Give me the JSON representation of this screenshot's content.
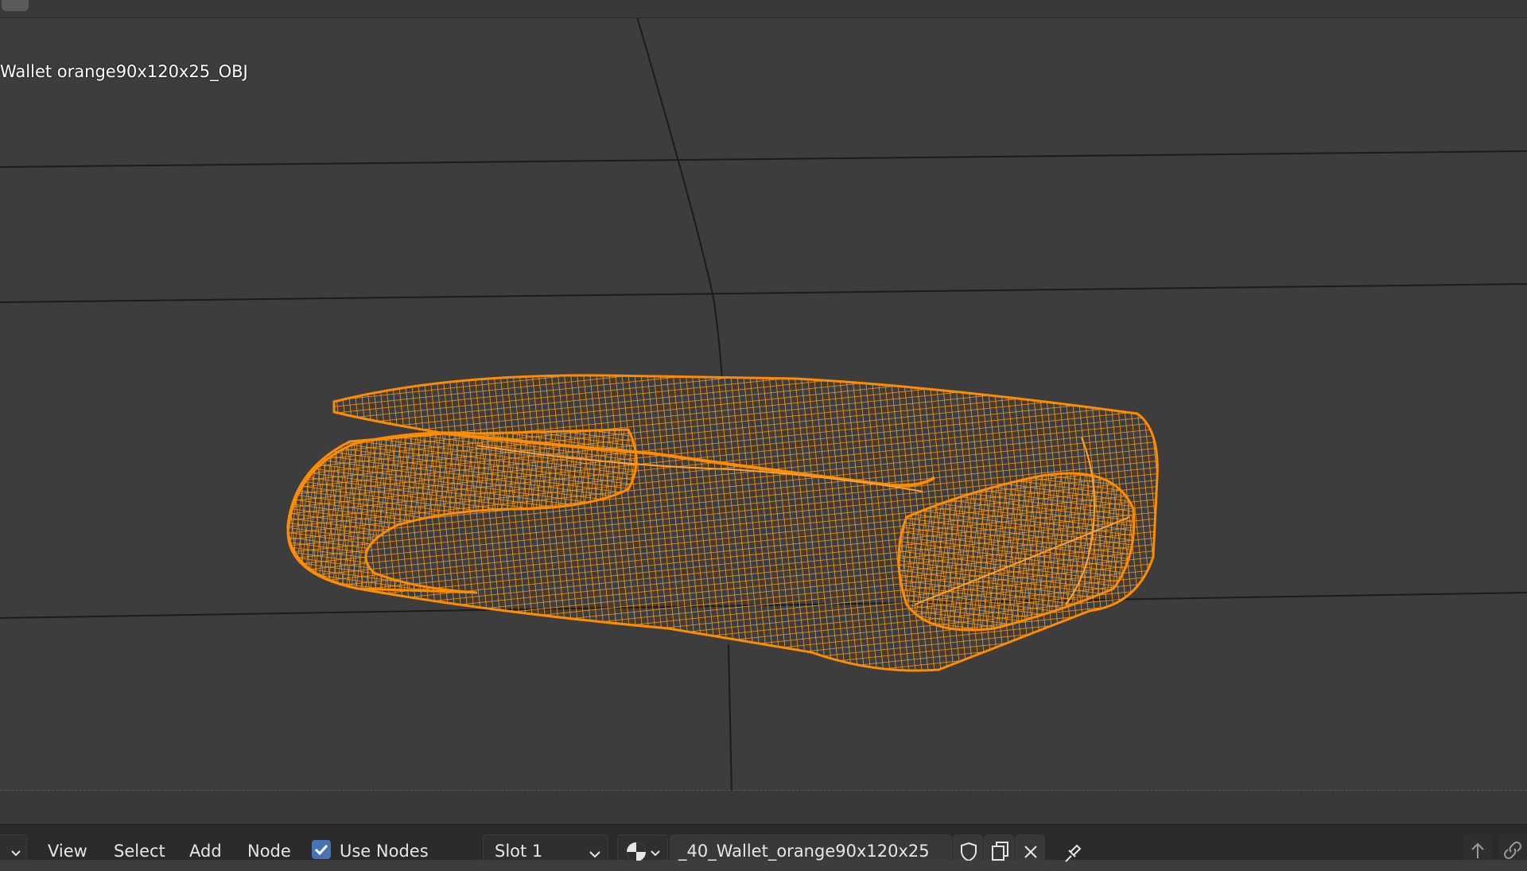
{
  "viewport": {
    "object_name": "Wallet orange90x120x25_OBJ",
    "wire_color": "#ff8c00",
    "background_color": "#3d3d3d"
  },
  "header": {
    "menu": {
      "view": "View",
      "select": "Select",
      "add": "Add",
      "node": "Node"
    },
    "use_nodes": {
      "label": "Use Nodes",
      "checked": true
    },
    "slot": "Slot 1",
    "material_name": "_40_Wallet_orange90x120x25",
    "icons": {
      "editor_type": "chevron-down-icon",
      "material_browse": "material-sphere-icon",
      "fake_user": "shield-icon",
      "duplicate": "duplicate-icon",
      "unlink": "close-icon",
      "pin": "pin-icon",
      "up": "arrow-up-icon",
      "link": "link-icon"
    }
  }
}
